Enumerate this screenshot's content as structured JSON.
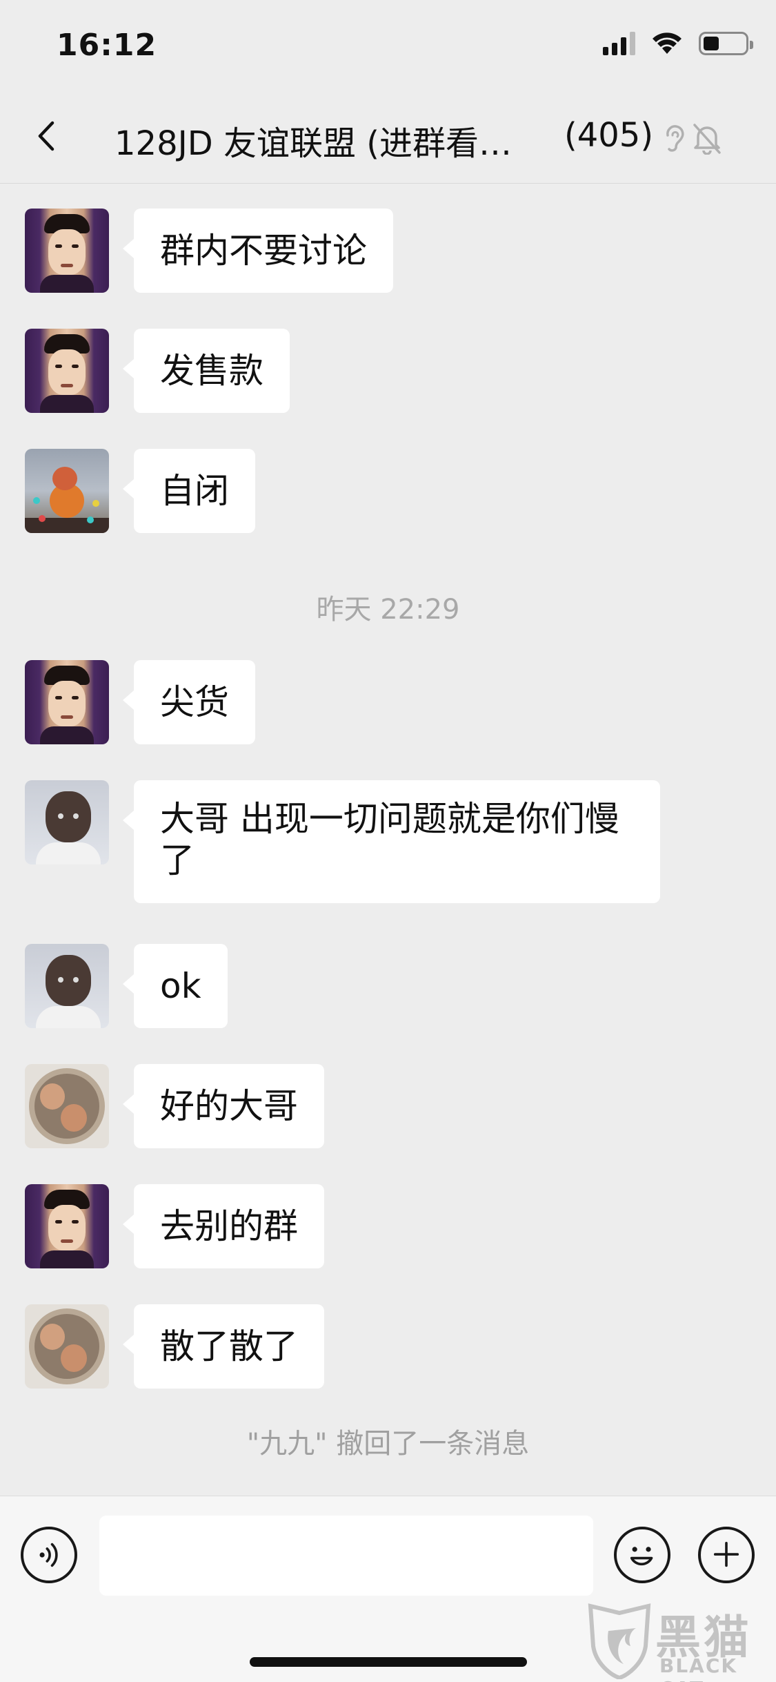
{
  "status_bar": {
    "time": "16:12"
  },
  "nav": {
    "title": "128JD 友谊联盟 (进群看…",
    "member_count": "(405)"
  },
  "messages": [
    {
      "avatar": "man-selfie-avatar",
      "text": "群内不要讨论"
    },
    {
      "avatar": "man-selfie-avatar",
      "text": "发售款"
    },
    {
      "avatar": "cartoon-avatar",
      "text": "自闭"
    },
    {
      "avatar": "man-selfie-avatar",
      "text": "尖货"
    },
    {
      "avatar": "child-avatar",
      "text": "大哥 出现一切问题就是你们慢了"
    },
    {
      "avatar": "child-avatar",
      "text": "ok"
    },
    {
      "avatar": "couple-avatar",
      "text": "好的大哥"
    },
    {
      "avatar": "man-selfie-avatar",
      "text": "去别的群"
    },
    {
      "avatar": "couple-avatar",
      "text": "散了散了"
    }
  ],
  "time_divider": "昨天 22:29",
  "system_note": "\"九九\" 撤回了一条消息",
  "input": {
    "value": "",
    "placeholder": ""
  },
  "watermark": {
    "cn": "黑猫",
    "en": "BLACK CAT"
  },
  "colors": {
    "background": "#ededed",
    "bubble": "#ffffff",
    "meta_text": "#a8a8a8"
  }
}
